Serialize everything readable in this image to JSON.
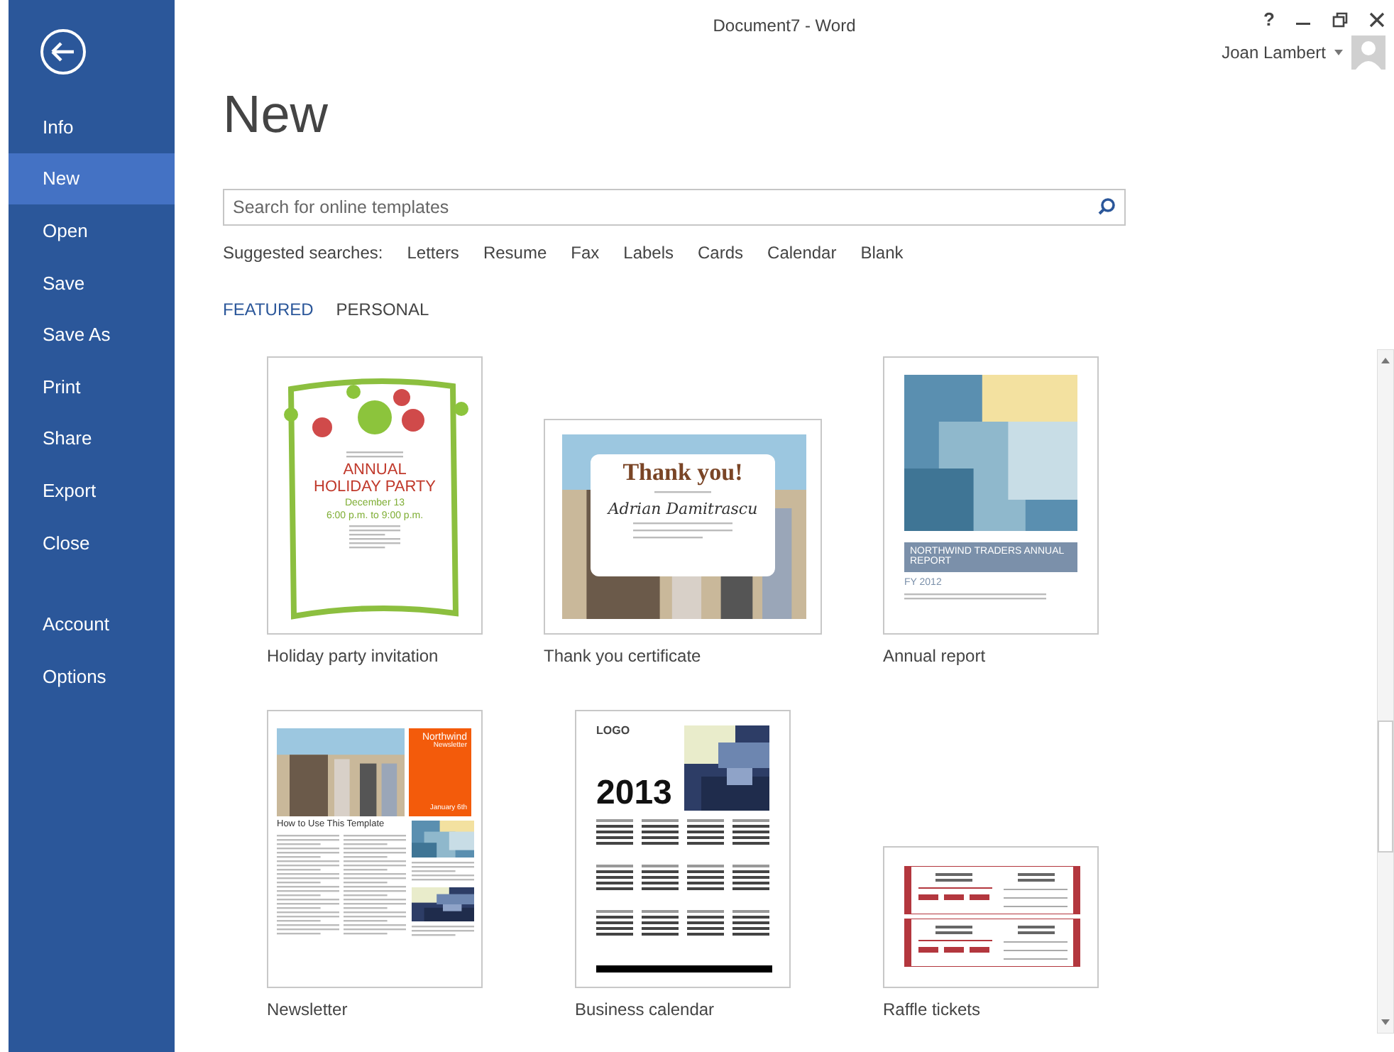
{
  "window": {
    "title": "Document7 - Word",
    "help": "?"
  },
  "user": {
    "name": "Joan Lambert"
  },
  "sidebar": {
    "groups": [
      [
        {
          "label": "Info",
          "selected": false
        },
        {
          "label": "New",
          "selected": true
        },
        {
          "label": "Open",
          "selected": false
        },
        {
          "label": "Save",
          "selected": false
        },
        {
          "label": "Save As",
          "selected": false
        },
        {
          "label": "Print",
          "selected": false
        },
        {
          "label": "Share",
          "selected": false
        },
        {
          "label": "Export",
          "selected": false
        },
        {
          "label": "Close",
          "selected": false
        }
      ],
      [
        {
          "label": "Account",
          "selected": false
        },
        {
          "label": "Options",
          "selected": false
        }
      ]
    ]
  },
  "page": {
    "title": "New"
  },
  "search": {
    "placeholder": "Search for online templates"
  },
  "suggested": {
    "label": "Suggested searches:",
    "items": [
      "Letters",
      "Resume",
      "Fax",
      "Labels",
      "Cards",
      "Calendar",
      "Blank"
    ]
  },
  "tabs": [
    {
      "label": "FEATURED",
      "selected": true
    },
    {
      "label": "PERSONAL",
      "selected": false
    }
  ],
  "templates": [
    {
      "name": "Holiday party invitation",
      "kind": "invitation",
      "texts": [
        "ANNUAL HOLIDAY PARTY",
        "December 13",
        "6:00 p.m. to 9:00 p.m."
      ]
    },
    {
      "name": "Thank you certificate",
      "kind": "certificate",
      "texts": [
        "Thank you!",
        "Adrian Damitrascu"
      ]
    },
    {
      "name": "Annual report",
      "kind": "report",
      "texts": [
        "NORTHWIND TRADERS ANNUAL REPORT",
        "FY 2012"
      ]
    },
    {
      "name": "Newsletter",
      "kind": "newsletter",
      "texts": [
        "Northwind",
        "Newsletter",
        "January 6th",
        "How to Use This Template"
      ]
    },
    {
      "name": "Business calendar",
      "kind": "calendar",
      "texts": [
        "LOGO",
        "2013"
      ]
    },
    {
      "name": "Raffle tickets",
      "kind": "raffle"
    }
  ]
}
